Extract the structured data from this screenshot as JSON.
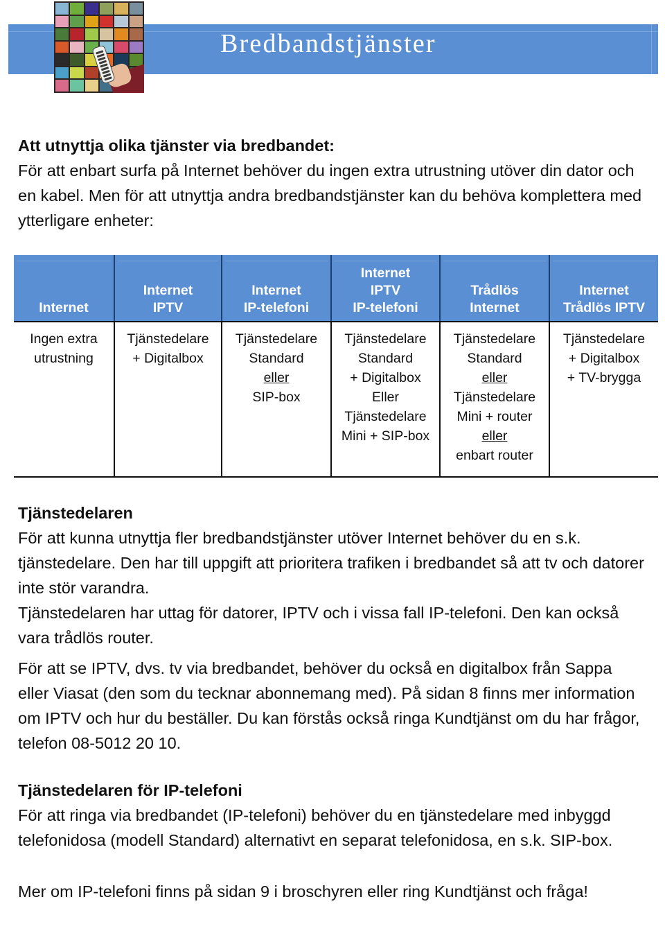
{
  "header": {
    "title": "Bredbandstjänster",
    "banner_color": "#5b8fd4",
    "photo_alt": "tv-mosaic-with-remote"
  },
  "intro": {
    "heading": "Att utnyttja olika tjänster via bredbandet:",
    "body": "För att enbart surfa på Internet behöver du ingen extra utrustning utöver din dator och en kabel. Men för att utnyttja andra bredbandstjänster kan du behöva komplettera med ytterligare enheter:"
  },
  "table": {
    "headers": [
      [
        "Internet"
      ],
      [
        "Internet",
        "IPTV"
      ],
      [
        "Internet",
        "IP-telefoni"
      ],
      [
        "Internet",
        "IPTV",
        "IP-telefoni"
      ],
      [
        "Trådlös",
        "Internet"
      ],
      [
        "Internet",
        "Trådlös IPTV"
      ]
    ],
    "rows": [
      [
        [
          {
            "text": "Ingen extra",
            "underline": false
          },
          {
            "text": "utrustning",
            "underline": false
          }
        ],
        [
          {
            "text": "Tjänstedelare",
            "underline": false
          },
          {
            "text": "+ Digitalbox",
            "underline": false
          }
        ],
        [
          {
            "text": "Tjänstedelare",
            "underline": false
          },
          {
            "text": "Standard",
            "underline": false
          },
          {
            "text": "eller",
            "underline": true
          },
          {
            "text": "SIP-box",
            "underline": false
          }
        ],
        [
          {
            "text": "Tjänstedelare",
            "underline": false
          },
          {
            "text": "Standard",
            "underline": false
          },
          {
            "text": "+ Digitalbox",
            "underline": false
          },
          {
            "text": "Eller",
            "underline": false
          },
          {
            "text": "Tjänstedelare",
            "underline": false
          },
          {
            "text": "Mini + SIP-box",
            "underline": false
          }
        ],
        [
          {
            "text": "Tjänstedelare",
            "underline": false
          },
          {
            "text": "Standard",
            "underline": false
          },
          {
            "text": "eller",
            "underline": true
          },
          {
            "text": "Tjänstedelare",
            "underline": false
          },
          {
            "text": "Mini + router",
            "underline": false
          },
          {
            "text": "eller",
            "underline": true
          },
          {
            "text": "enbart router",
            "underline": false
          }
        ],
        [
          {
            "text": "Tjänstedelare",
            "underline": false
          },
          {
            "text": "+ Digitalbox",
            "underline": false
          },
          {
            "text": "+ TV-brygga",
            "underline": false
          }
        ]
      ]
    ]
  },
  "section1": {
    "heading": "Tjänstedelaren",
    "para1": "För att kunna utnyttja fler bredbandstjänster utöver Internet behöver du en s.k. tjänstedelare. Den har till uppgift att prioritera trafiken i bredbandet så att tv och datorer inte stör varandra.",
    "para2": "Tjänstedelaren har uttag för datorer, IPTV och i vissa fall IP-telefoni. Den kan också vara trådlös router.",
    "para3": "För att se IPTV, dvs. tv via bredbandet, behöver du också en digitalbox från Sappa eller Viasat (den som du tecknar abonnemang med). På sidan 8 finns mer information om IPTV och hur du beställer.  Du kan förstås också ringa Kundtjänst om du har frågor, telefon 08-5012 20 10."
  },
  "section2": {
    "heading": "Tjänstedelaren för IP-telefoni",
    "para1": "För att ringa via bredbandet (IP-telefoni) behöver du en tjänstedelare med inbyggd telefonidosa (modell Standard) alternativt en separat telefonidosa, en s.k. SIP-box.",
    "para2": "Mer om IP-telefoni finns på sidan 9 i broschyren eller ring Kundtjänst och fråga!"
  },
  "mosaic_colors": [
    "#8ab6d6",
    "#6fae3a",
    "#3a2f8f",
    "#8fa05a",
    "#d8b25a",
    "#7a8f9e",
    "#e8a0b8",
    "#5f9e4a",
    "#e0a317",
    "#d2322d",
    "#b7c9d8",
    "#caa184",
    "#4a7a3a",
    "#b8242c",
    "#9ec94a",
    "#d8c3a0",
    "#e08a20",
    "#a8684a",
    "#d85a2a",
    "#e8b4c0",
    "#6ab04a",
    "#8fc4d8",
    "#d84a6a",
    "#9c7ac4",
    "#2a2a2a",
    "#3d5a2a",
    "#d8d040",
    "#e86a20",
    "#1a3a5a",
    "#5a8a30",
    "#4aa0c8",
    "#c8d84a",
    "#b0402a",
    "#e8c86a",
    "#6a4a8a",
    "#2a6a4a",
    "#d86a8a",
    "#6ac4a0",
    "#e8d08a",
    "#40708a",
    "#c84a30",
    "#7ab440"
  ]
}
